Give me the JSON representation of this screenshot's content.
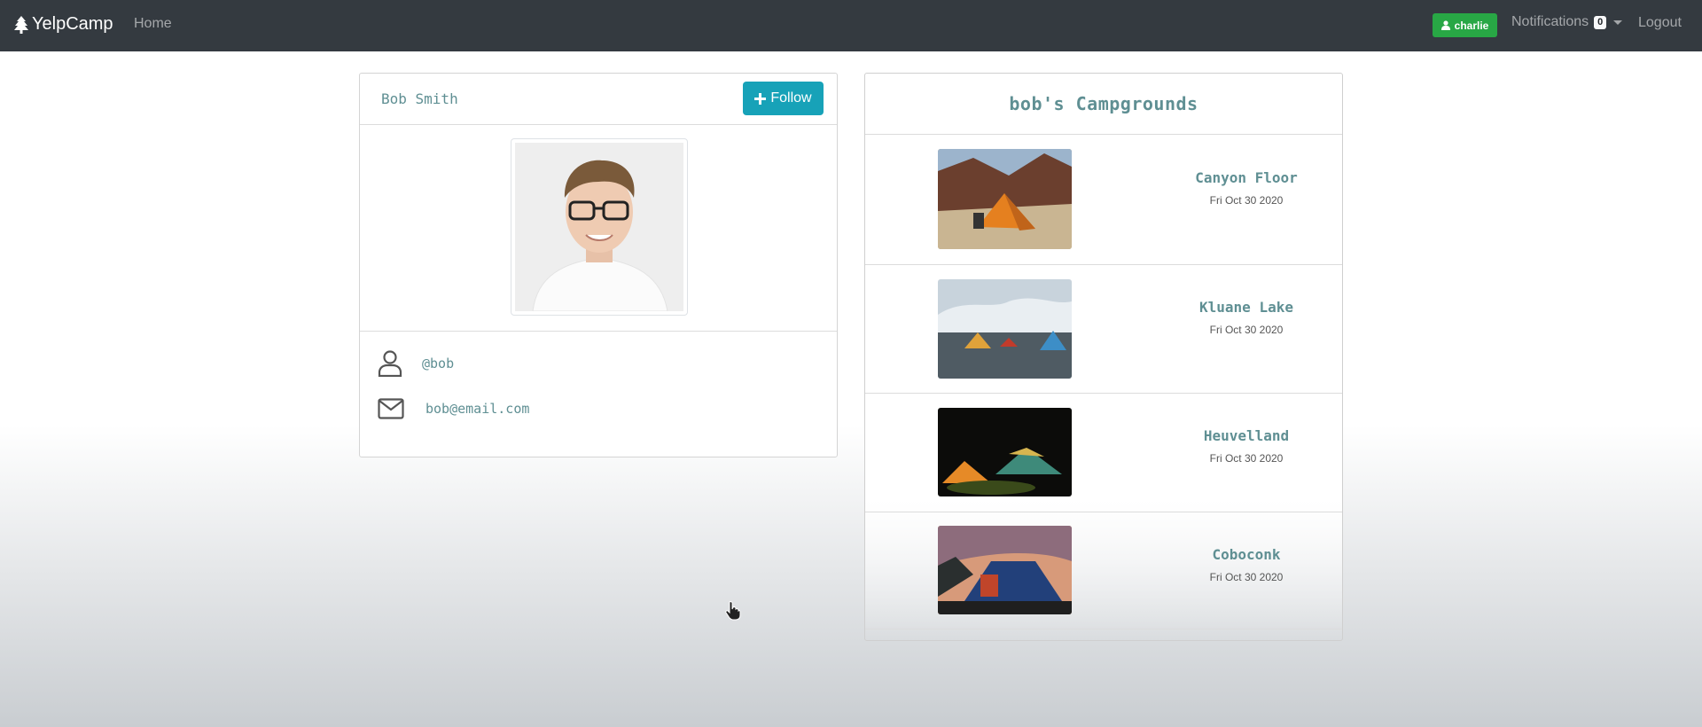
{
  "navbar": {
    "brand": "YelpCamp",
    "home": "Home",
    "user": "charlie",
    "notifications": "Notifications",
    "notification_count": "0",
    "logout": "Logout"
  },
  "profile": {
    "name": "Bob Smith",
    "follow_label": "Follow",
    "username": "@bob",
    "email": "bob@email.com"
  },
  "campgrounds": {
    "title": "bob's Campgrounds",
    "items": [
      {
        "name": "Canyon Floor",
        "date": "Fri Oct 30 2020"
      },
      {
        "name": "Kluane Lake",
        "date": "Fri Oct 30 2020"
      },
      {
        "name": "Heuvelland",
        "date": "Fri Oct 30 2020"
      },
      {
        "name": "Coboconk",
        "date": "Fri Oct 30 2020"
      }
    ]
  },
  "colors": {
    "navbar": "#343a40",
    "follow": "#17a2b8",
    "user_badge": "#28a745",
    "accent_text": "#5f8f93"
  }
}
